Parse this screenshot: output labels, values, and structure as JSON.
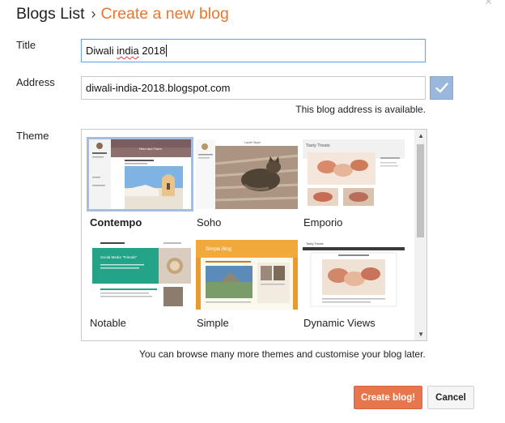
{
  "header": {
    "crumb": "Blogs List",
    "separator": "›",
    "title": "Create a new blog"
  },
  "close_glyph": "×",
  "form": {
    "title_label": "Title",
    "title_value_plain": "Diwali ",
    "title_value_misspelled": "india",
    "title_value_rest": " 2018",
    "address_label": "Address",
    "address_value": "diwali-india-2018.blogspot.com",
    "availability": "This blog address is available.",
    "theme_label": "Theme"
  },
  "themes": [
    {
      "name": "Contempo",
      "selected": true,
      "thumb_text": "Here and There"
    },
    {
      "name": "Soho",
      "selected": false,
      "thumb_text": "Laurie Taylor"
    },
    {
      "name": "Emporio",
      "selected": false,
      "thumb_text": "Tasty Treats"
    },
    {
      "name": "Notable",
      "selected": false,
      "thumb_text": "Social Media \"Friends\""
    },
    {
      "name": "Simple",
      "selected": false,
      "thumb_text": "Simple Blog"
    },
    {
      "name": "Dynamic Views",
      "selected": false,
      "thumb_text": "Tasty Treats"
    }
  ],
  "footnote": "You can browse many more themes and customise your blog later.",
  "buttons": {
    "create": "Create blog!",
    "cancel": "Cancel"
  },
  "colors": {
    "accent_orange": "#e8762d",
    "create_button": "#e8764d",
    "check_button": "#9ab7dc",
    "focus_border": "#6aa6e6"
  }
}
